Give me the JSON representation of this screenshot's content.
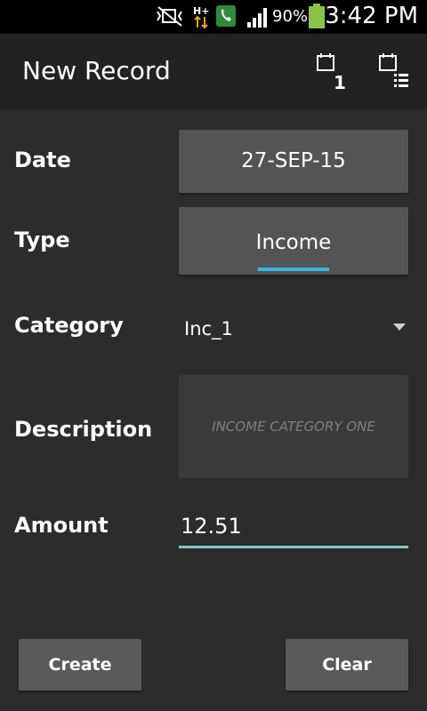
{
  "status_bar": {
    "battery_percent": "90%",
    "time": "3:42 PM",
    "icons": [
      "mute-vibrate-icon",
      "data-hplus-icon",
      "call-icon",
      "signal-icon",
      "battery-icon"
    ],
    "battery_color": "#8bc34a"
  },
  "action_bar": {
    "title": "New Record",
    "day_view_badge": "1",
    "icons": [
      "calendar-day-icon",
      "calendar-list-icon"
    ]
  },
  "form": {
    "date_label": "Date",
    "date_value": "27-SEP-15",
    "type_label": "Type",
    "type_value": "Income",
    "category_label": "Category",
    "category_value": "Inc_1",
    "description_label": "Description",
    "description_placeholder": "INCOME CATEGORY ONE",
    "amount_label": "Amount",
    "amount_value": "12.51"
  },
  "buttons": {
    "create": "Create",
    "clear": "Clear"
  },
  "colors": {
    "background": "#2c2c2c",
    "action_bar": "#222222",
    "status_bar": "#000000",
    "accent_blue": "#33b5e5",
    "amount_underline": "#80cbc4",
    "button_gray": "#545454"
  }
}
